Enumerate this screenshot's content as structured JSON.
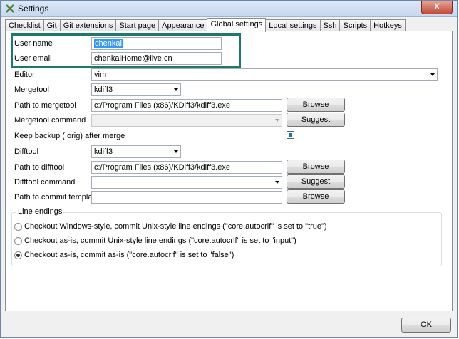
{
  "window": {
    "title": "Settings",
    "close_glyph": "X",
    "app_icon": "git-extensions-icon"
  },
  "tabs": [
    {
      "label": "Checklist"
    },
    {
      "label": "Git"
    },
    {
      "label": "Git extensions"
    },
    {
      "label": "Start page"
    },
    {
      "label": "Appearance"
    },
    {
      "label": "Global settings",
      "active": true
    },
    {
      "label": "Local settings"
    },
    {
      "label": "Ssh"
    },
    {
      "label": "Scripts"
    },
    {
      "label": "Hotkeys"
    }
  ],
  "form": {
    "user_name": {
      "label": "User name",
      "value": "chenkai"
    },
    "user_email": {
      "label": "User email",
      "value": "chenkaiHome@live.cn"
    },
    "editor": {
      "label": "Editor",
      "value": "vim"
    },
    "mergetool": {
      "label": "Mergetool",
      "value": "kdiff3"
    },
    "path_to_mergetool": {
      "label": "Path to mergetool",
      "value": "c:/Program Files (x86)/KDiff3/kdiff3.exe",
      "button": "Browse"
    },
    "mergetool_command": {
      "label": "Mergetool command",
      "value": "",
      "button": "Suggest"
    },
    "keep_backup": {
      "label": "Keep backup (.orig) after merge",
      "checked": true
    },
    "difftool": {
      "label": "Difftool",
      "value": "kdiff3"
    },
    "path_to_difftool": {
      "label": "Path to difftool",
      "value": "c:/Program Files (x86)/KDiff3/kdiff3.exe",
      "button": "Browse"
    },
    "difftool_command": {
      "label": "Difftool command",
      "value": "",
      "button": "Suggest"
    },
    "commit_template": {
      "label": "Path to commit template",
      "value": "",
      "button": "Browse"
    }
  },
  "line_endings": {
    "title": "Line endings",
    "options": [
      {
        "label": "Checkout Windows-style, commit Unix-style line endings (\"core.autocrlf\"  is set to \"true\")",
        "selected": false
      },
      {
        "label": "Checkout as-is, commit Unix-style line endings (\"core.autocrlf\"  is set to \"input\")",
        "selected": false
      },
      {
        "label": "Checkout as-is, commit as-is (\"core.autocrlf\"  is set to \"false\")",
        "selected": true
      }
    ]
  },
  "footer": {
    "ok_label": "OK"
  },
  "colors": {
    "highlight_box": "#1b7a6d",
    "selection": "#3399ff"
  }
}
